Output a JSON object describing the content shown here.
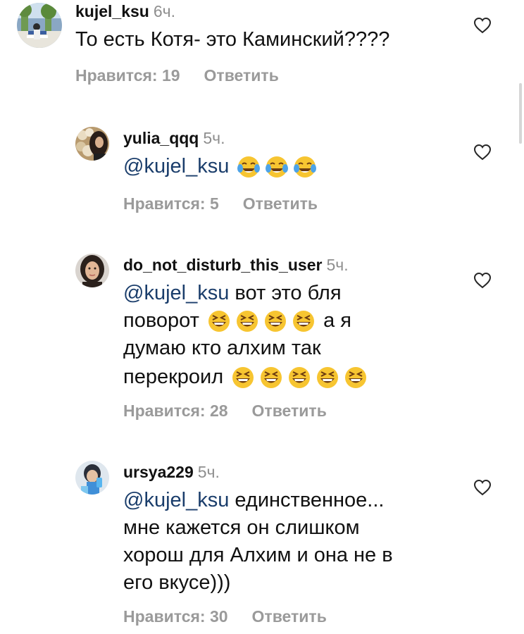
{
  "comments": [
    {
      "username": "kujel_ksu",
      "time": "6ч.",
      "text": "То есть Котя- это Каминский????",
      "likes": "Нравится: 19",
      "reply": "Ответить"
    },
    {
      "username": "yulia_qqq",
      "time": "5ч.",
      "mention": "@kujel_ksu",
      "emoji": [
        "face-with-tears-of-joy",
        "face-with-tears-of-joy",
        "face-with-tears-of-joy"
      ],
      "likes": "Нравится: 5",
      "reply": "Ответить"
    },
    {
      "username": "do_not_disturb_this_user",
      "time": "5ч.",
      "mention": "@kujel_ksu",
      "line1_text": "вот это бля",
      "line2_text": "поворот",
      "line2_tail": "а я",
      "line3_text": "думаю кто алхим так",
      "line4_text": "перекроил",
      "emoji": [
        "grinning-squinting-face"
      ],
      "likes": "Нравится: 28",
      "reply": "Ответить"
    },
    {
      "username": "ursya229",
      "time": "5ч.",
      "mention": "@kujel_ksu",
      "line1_text": "единственное...",
      "line2_text": "мне кажется он слишком",
      "line3_text": "хорош для Алхим и она не в",
      "line4_text": "его вкусе)))",
      "likes": "Нравится: 30",
      "reply": "Ответить"
    }
  ],
  "icons": {
    "like": "heart-outline-icon"
  },
  "colors": {
    "mention": "#1a3d6b",
    "meta": "#9a9a9a",
    "emoji_face": "#f7c531"
  }
}
